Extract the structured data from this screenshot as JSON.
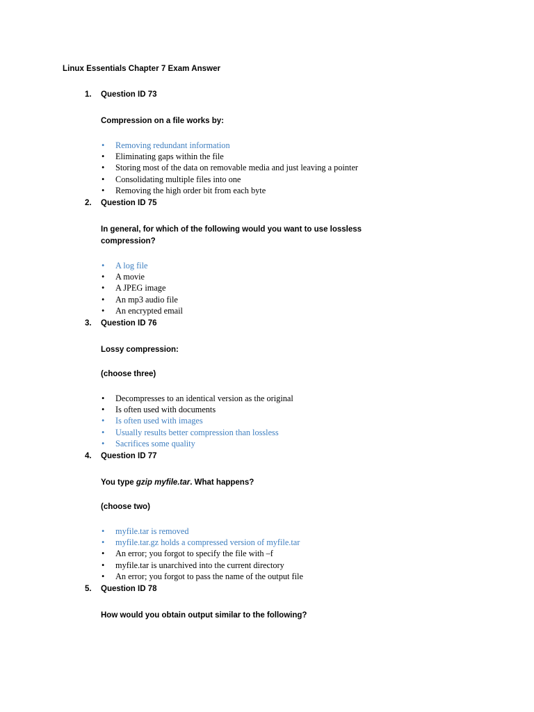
{
  "document": {
    "title": "Linux Essentials Chapter 7 Exam Answer",
    "accent_color": "#3f7fc0",
    "text_color": "#000000",
    "background_color": "#ffffff",
    "bullet_glyph": "•"
  },
  "questions": [
    {
      "number": "1.",
      "heading": "Question ID 73",
      "prompt": "Compression on a file works by:",
      "choose": "",
      "answers": [
        {
          "text": "Removing redundant information",
          "correct": true
        },
        {
          "text": "Eliminating gaps within the file",
          "correct": false
        },
        {
          "text": "Storing most of the data on removable media and just leaving a pointer",
          "correct": false
        },
        {
          "text": "Consolidating multiple files into one",
          "correct": false
        },
        {
          "text": "Removing the high order bit from each byte",
          "correct": false
        }
      ]
    },
    {
      "number": "2.",
      "heading": "Question ID 75",
      "prompt": "In general, for which of the following would you want to use lossless compression?",
      "choose": "",
      "answers": [
        {
          "text": "A log file",
          "correct": true
        },
        {
          "text": "A movie",
          "correct": false
        },
        {
          "text": "A JPEG image",
          "correct": false
        },
        {
          "text": "An mp3 audio file",
          "correct": false
        },
        {
          "text": "An encrypted email",
          "correct": false
        }
      ]
    },
    {
      "number": "3.",
      "heading": "Question ID 76",
      "prompt": "Lossy compression:",
      "choose": "(choose three)",
      "answers": [
        {
          "text": "Decompresses to an identical version as the original",
          "correct": false
        },
        {
          "text": "Is often used with documents",
          "correct": false
        },
        {
          "text": "Is often used with images",
          "correct": true
        },
        {
          "text": "Usually results better compression than lossless",
          "correct": true
        },
        {
          "text": "Sacrifices some quality",
          "correct": true
        }
      ]
    },
    {
      "number": "4.",
      "heading": "Question ID 77",
      "prompt_parts": [
        {
          "text": "You type ",
          "italic": false
        },
        {
          "text": "gzip myfile.tar",
          "italic": true
        },
        {
          "text": ". What happens?",
          "italic": false
        }
      ],
      "choose": "(choose two)",
      "answers": [
        {
          "text": "myfile.tar is removed",
          "correct": true
        },
        {
          "text": "myfile.tar.gz holds a compressed version of myfile.tar",
          "correct": true
        },
        {
          "text": "An error; you forgot to specify the file with –f",
          "correct": false
        },
        {
          "text": "myfile.tar is unarchived into the current directory",
          "correct": false
        },
        {
          "text": "An error; you forgot to pass the name of the output file",
          "correct": false
        }
      ]
    },
    {
      "number": "5.",
      "heading": "Question ID 78",
      "prompt": "How would you obtain output similar to the following?",
      "choose": "",
      "answers": []
    }
  ]
}
